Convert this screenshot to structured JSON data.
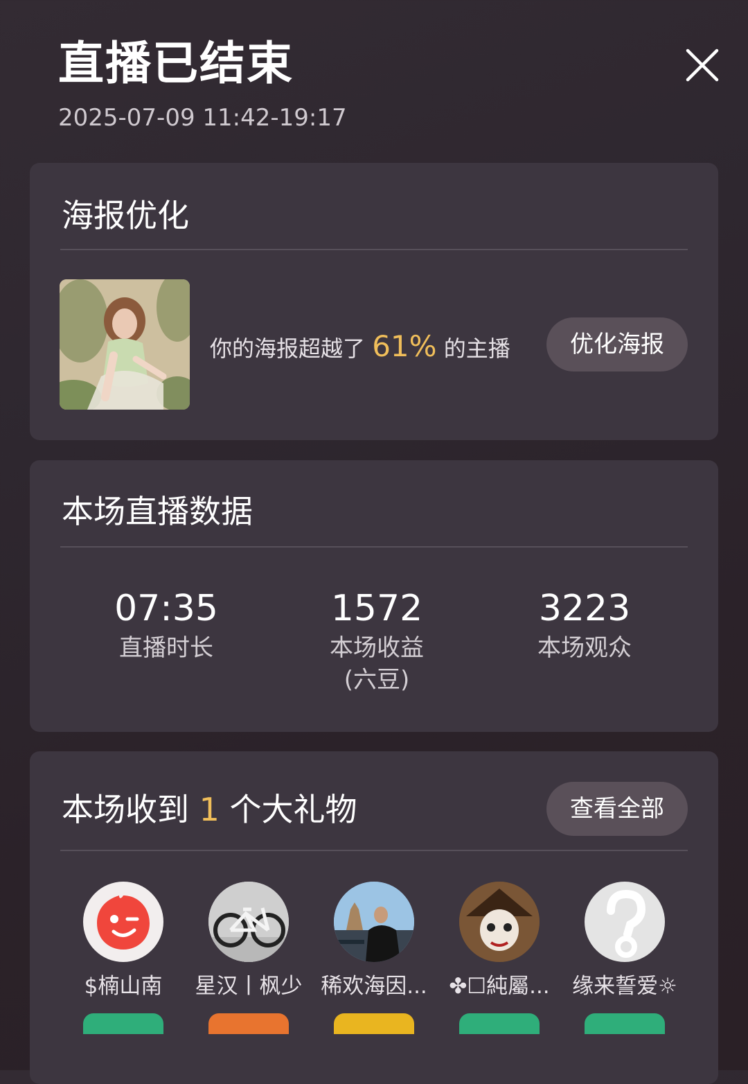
{
  "header": {
    "title": "直播已结束",
    "time_range": "2025-07-09 11:42-19:17"
  },
  "poster_section": {
    "title": "海报优化",
    "text_before": "你的海报超越了",
    "percent": "61%",
    "text_after": "的主播",
    "button_label": "优化海报"
  },
  "stats_section": {
    "title": "本场直播数据",
    "stats": [
      {
        "value": "07:35",
        "label": "直播时长"
      },
      {
        "value": "1572",
        "label": "本场收益\n(六豆)"
      },
      {
        "value": "3223",
        "label": "本场观众"
      }
    ]
  },
  "gifts_section": {
    "title_before": "本场收到",
    "count": "1",
    "title_after": "个大礼物",
    "button_label": "查看全部",
    "gifters": [
      {
        "name": "$楠山南",
        "badge_color": "#2fae7a"
      },
      {
        "name": "星汉丨枫少",
        "badge_color": "#e8742f"
      },
      {
        "name": "稀欢海因...",
        "badge_color": "#e9b520"
      },
      {
        "name": "✤☐純屬...",
        "badge_color": "#2fae7a"
      },
      {
        "name": "缘来誓爱☼",
        "badge_color": "#2fae7a"
      }
    ]
  },
  "colors": {
    "accent": "#f0be5a",
    "card_bg": "#3d3640",
    "button_bg": "#5a5059"
  }
}
